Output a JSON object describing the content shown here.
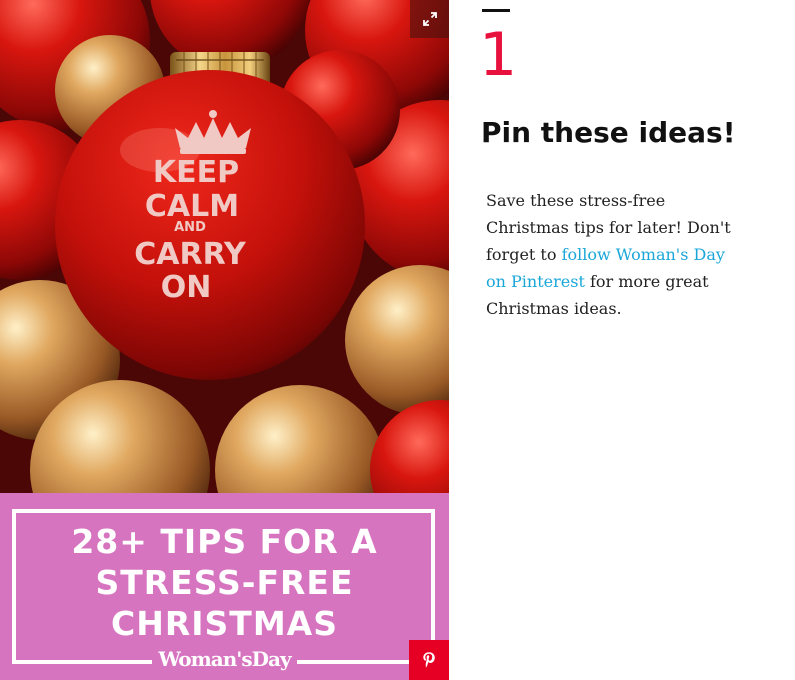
{
  "image": {
    "ornament": {
      "lines": [
        "KEEP",
        "CALM",
        "AND",
        "CARRY",
        "ON"
      ]
    },
    "banner": {
      "title_lines": [
        "28+ TIPS FOR A",
        "STRESS-FREE",
        "CHRISTMAS"
      ],
      "brand": "Woman'sDay",
      "color": "#d774c0"
    },
    "expand_icon": "expand-icon",
    "pinterest_icon": "pinterest-icon",
    "pinterest_color": "#e60023"
  },
  "slide": {
    "number": "1",
    "title": "Pin these ideas!",
    "body": {
      "text_before": "Save these stress-free Christmas tips for later! Don't forget to ",
      "link_text": "follow Woman's Day on Pinterest",
      "text_after": " for more great Christmas ideas."
    },
    "accent_color": "#e8103d",
    "link_color": "#1aa7d8"
  }
}
